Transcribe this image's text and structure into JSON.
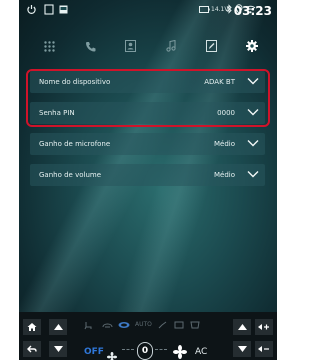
{
  "status_bar": {
    "voltage": "14.1V",
    "time": "03:23",
    "icons": [
      "power-icon",
      "recent-apps-icon",
      "image-icon",
      "battery-icon",
      "bluetooth-icon",
      "location-icon",
      "wifi-icon"
    ]
  },
  "tabs": [
    {
      "id": "apps",
      "icon": "grid-icon"
    },
    {
      "id": "phone",
      "icon": "phone-icon"
    },
    {
      "id": "contacts",
      "icon": "contacts-icon"
    },
    {
      "id": "music",
      "icon": "music-icon"
    },
    {
      "id": "edit",
      "icon": "edit-icon"
    },
    {
      "id": "settings",
      "icon": "gear-icon",
      "active": true
    }
  ],
  "settings": [
    {
      "label": "Nome do dispositivo",
      "value": "ADAK BT"
    },
    {
      "label": "Senha PIN",
      "value": "0000"
    },
    {
      "label": "Ganho de microfone",
      "value": "Médio"
    },
    {
      "label": "Ganho de volume",
      "value": "Médio"
    }
  ],
  "climate": {
    "auto_label": "AUTO",
    "off_label": "OFF",
    "fan_level": "0",
    "ac_label": "AC"
  },
  "colors": {
    "highlight": "#d0132a",
    "off_text": "#2f77d9",
    "background": "#1b4a4f"
  }
}
